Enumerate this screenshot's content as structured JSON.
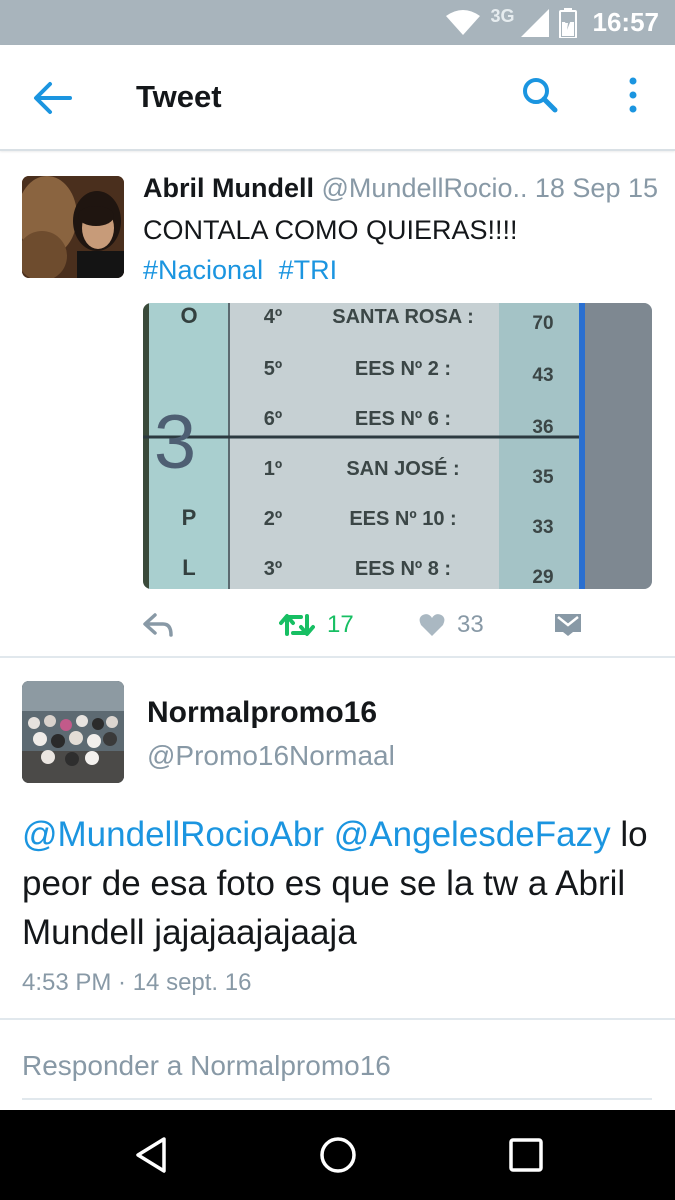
{
  "status_bar": {
    "time": "16:57",
    "network": "3G",
    "icons": [
      "wifi-icon",
      "signal-icon",
      "battery-icon"
    ]
  },
  "app_bar": {
    "title": "Tweet",
    "icons": [
      "back-arrow-icon",
      "search-icon",
      "more-vert-icon"
    ]
  },
  "tweet_original": {
    "name": "Abril Mundell",
    "handle": "@MundellRocio...",
    "date": "18 Sep 15",
    "text": "CONTALA COMO QUIERAS!!!!",
    "hashtags": [
      "#Nacional",
      "#TRI"
    ],
    "media": {
      "col_left_top": "O",
      "big_number": "3",
      "col_left_p": "P",
      "col_left_l": "L",
      "rows": [
        {
          "pos": "4º",
          "team": "SANTA ROSA :",
          "score": "70"
        },
        {
          "pos": "5º",
          "team": "EES Nº 2  :",
          "score": "43"
        },
        {
          "pos": "6º",
          "team": "EES Nº 6  :",
          "score": "36"
        },
        {
          "pos": "1º",
          "team": "SAN JOSÉ  :",
          "score": "35"
        },
        {
          "pos": "2º",
          "team": "EES Nº 10  :",
          "score": "33"
        },
        {
          "pos": "3º",
          "team": "EES Nº 8  :",
          "score": "29"
        }
      ]
    },
    "actions": {
      "retweets": "17",
      "likes": "33"
    },
    "colors": {
      "retweet_active": "#17bf63",
      "link": "#1b95e0",
      "muted": "#8899a6"
    }
  },
  "tweet_reply": {
    "name": "Normalpromo16",
    "handle": "@Promo16Normaal",
    "mention1": "@MundellRocioAbr",
    "mention2": "@AngelesdeFazy",
    "text": "lo peor de esa foto es que se la tw a Abril Mundell jajajaajajaaja",
    "timestamp": "4:53 PM · 14 sept. 16"
  },
  "reply_box": {
    "placeholder": "Responder a Normalpromo16"
  },
  "nav_bar": {
    "icons": [
      "nav-back-icon",
      "nav-home-icon",
      "nav-recents-icon"
    ]
  }
}
